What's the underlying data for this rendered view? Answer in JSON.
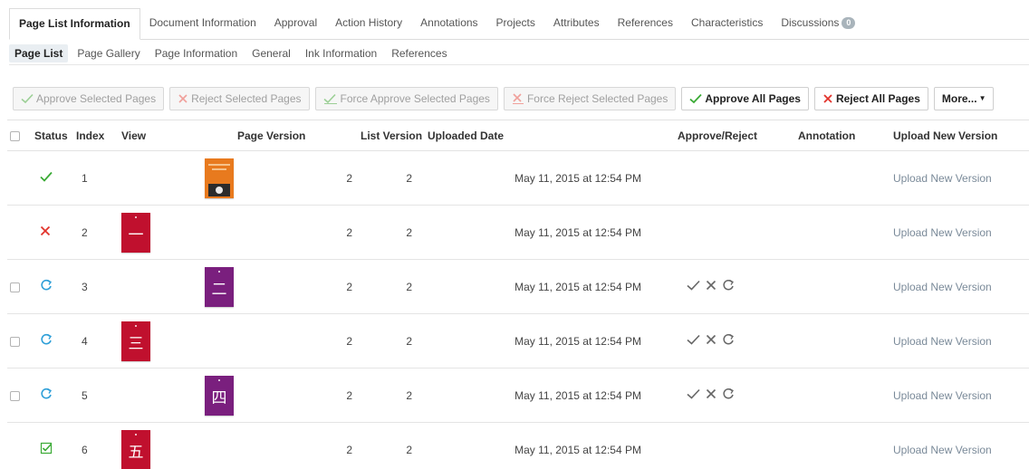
{
  "top_tabs": [
    {
      "label": "Page List Information",
      "active": true
    },
    {
      "label": "Document Information"
    },
    {
      "label": "Approval"
    },
    {
      "label": "Action History"
    },
    {
      "label": "Annotations"
    },
    {
      "label": "Projects"
    },
    {
      "label": "Attributes"
    },
    {
      "label": "References"
    },
    {
      "label": "Characteristics"
    },
    {
      "label": "Discussions",
      "badge": "0"
    }
  ],
  "sub_tabs": [
    {
      "label": "Page List",
      "active": true
    },
    {
      "label": "Page Gallery"
    },
    {
      "label": "Page Information"
    },
    {
      "label": "General"
    },
    {
      "label": "Ink Information"
    },
    {
      "label": "References"
    }
  ],
  "toolbar": {
    "approve_selected": "Approve Selected Pages",
    "reject_selected": "Reject Selected Pages",
    "force_approve_selected": "Force Approve Selected Pages",
    "force_reject_selected": "Force Reject Selected Pages",
    "approve_all": "Approve All Pages",
    "reject_all": "Reject All Pages",
    "more": "More..."
  },
  "table": {
    "headers": {
      "status": "Status",
      "index": "Index",
      "view": "View",
      "page_version": "Page Version",
      "list_version": "List Version",
      "uploaded_date": "Uploaded Date",
      "approve_reject": "Approve/Reject",
      "annotation": "Annotation",
      "upload_new_version": "Upload New Version"
    },
    "rows": [
      {
        "status": "approved",
        "index": "1",
        "thumb_text": "",
        "thumb_color": "#e87a1e",
        "thumb_pos": "right",
        "page_version": "2",
        "list_version": "2",
        "uploaded": "May 11, 2015 at 12:54 PM",
        "has_checkbox": false,
        "has_actions": false,
        "upload": "Upload New Version"
      },
      {
        "status": "rejected",
        "index": "2",
        "thumb_text": "一",
        "thumb_color": "#c0102e",
        "thumb_pos": "left",
        "page_version": "2",
        "list_version": "2",
        "uploaded": "May 11, 2015 at 12:54 PM",
        "has_checkbox": false,
        "has_actions": false,
        "upload": "Upload New Version"
      },
      {
        "status": "pending",
        "index": "3",
        "thumb_text": "二",
        "thumb_color": "#7a1f7e",
        "thumb_pos": "right",
        "page_version": "2",
        "list_version": "2",
        "uploaded": "May 11, 2015 at 12:54 PM",
        "has_checkbox": true,
        "has_actions": true,
        "upload": "Upload New Version"
      },
      {
        "status": "pending",
        "index": "4",
        "thumb_text": "三",
        "thumb_color": "#c0102e",
        "thumb_pos": "left",
        "page_version": "2",
        "list_version": "2",
        "uploaded": "May 11, 2015 at 12:54 PM",
        "has_checkbox": true,
        "has_actions": true,
        "upload": "Upload New Version"
      },
      {
        "status": "pending",
        "index": "5",
        "thumb_text": "四",
        "thumb_color": "#7a1f7e",
        "thumb_pos": "right",
        "page_version": "2",
        "list_version": "2",
        "uploaded": "May 11, 2015 at 12:54 PM",
        "has_checkbox": true,
        "has_actions": true,
        "upload": "Upload New Version"
      },
      {
        "status": "force-approved",
        "index": "6",
        "thumb_text": "五",
        "thumb_color": "#c0102e",
        "thumb_pos": "left",
        "page_version": "2",
        "list_version": "2",
        "uploaded": "May 11, 2015 at 12:54 PM",
        "has_checkbox": false,
        "has_actions": false,
        "upload": "Upload New Version"
      }
    ]
  },
  "colors": {
    "approve_green": "#3aaa35",
    "reject_red": "#e2332b",
    "pending_blue": "#2e9fd8",
    "action_grey": "#666666"
  }
}
